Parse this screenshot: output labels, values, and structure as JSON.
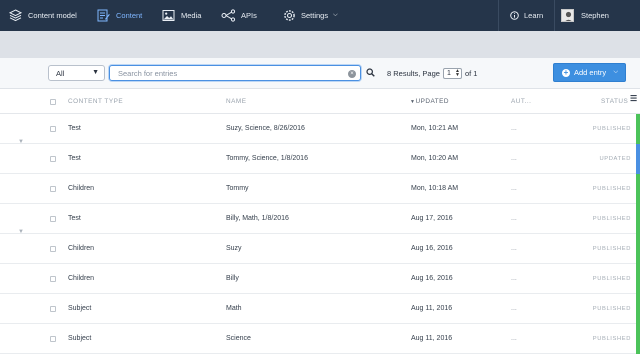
{
  "nav": {
    "items": [
      {
        "label": "Content model",
        "icon": "layers-icon"
      },
      {
        "label": "Content",
        "icon": "content-edit-icon",
        "active": true
      },
      {
        "label": "Media",
        "icon": "image-icon"
      },
      {
        "label": "APIs",
        "icon": "api-nodes-icon"
      },
      {
        "label": "Settings",
        "icon": "gear-icon"
      }
    ],
    "learn": "Learn",
    "user": "Stephen"
  },
  "toolbar": {
    "filter_value": "All",
    "search_placeholder": "Search for entries",
    "results_text": "8 Results, Page",
    "page": "1",
    "of_text": "of 1",
    "add_label": "Add entry"
  },
  "table": {
    "headers": {
      "content_type": "Content Type",
      "name": "Name",
      "updated": "Updated",
      "author": "Aut...",
      "status": "Status"
    },
    "rows": [
      {
        "type": "Test",
        "name": "Suzy, Science, 8/26/2016",
        "updated": "Mon, 10:21 AM",
        "author": "...",
        "status": "Published",
        "color": "#4cc35a",
        "expander": false
      },
      {
        "type": "Test",
        "name": "Tommy, Science, 1/8/2016",
        "updated": "Mon, 10:20 AM",
        "author": "...",
        "status": "Updated",
        "color": "#4a90e2",
        "expander": true
      },
      {
        "type": "Children",
        "name": "Tommy",
        "updated": "Mon, 10:18 AM",
        "author": "...",
        "status": "Published",
        "color": "#4cc35a",
        "expander": false
      },
      {
        "type": "Test",
        "name": "Billy, Math, 1/8/2016",
        "updated": "Aug 17, 2016",
        "author": "...",
        "status": "Published",
        "color": "#4cc35a",
        "expander": false
      },
      {
        "type": "Children",
        "name": "Suzy",
        "updated": "Aug 16, 2016",
        "author": "...",
        "status": "Published",
        "color": "#4cc35a",
        "expander": true
      },
      {
        "type": "Children",
        "name": "Billy",
        "updated": "Aug 16, 2016",
        "author": "...",
        "status": "Published",
        "color": "#4cc35a",
        "expander": false
      },
      {
        "type": "Subject",
        "name": "Math",
        "updated": "Aug 11, 2016",
        "author": "...",
        "status": "Published",
        "color": "#4cc35a",
        "expander": false
      },
      {
        "type": "Subject",
        "name": "Science",
        "updated": "Aug 11, 2016",
        "author": "...",
        "status": "Published",
        "color": "#4cc35a",
        "expander": false
      }
    ]
  },
  "colors": {
    "nav_bg": "#25354a",
    "accent": "#3d8fe0",
    "published": "#4cc35a",
    "updated": "#4a90e2"
  }
}
